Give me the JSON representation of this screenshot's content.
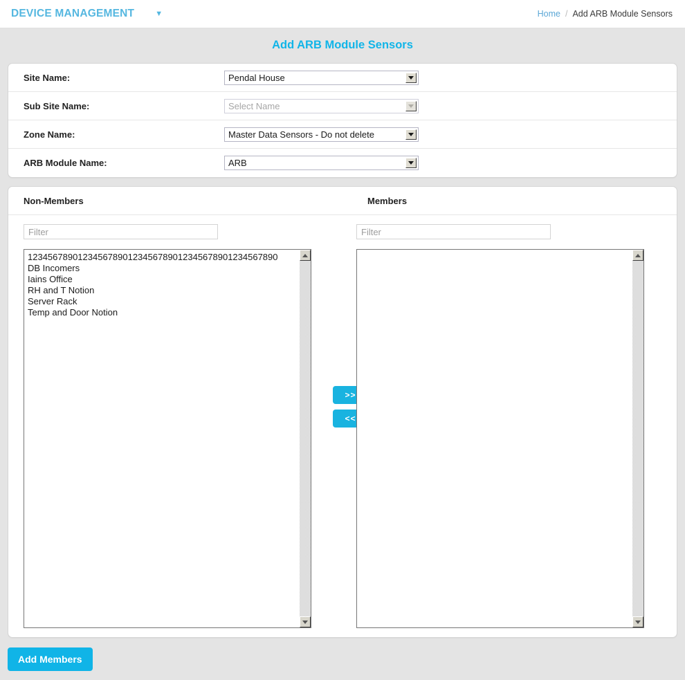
{
  "header": {
    "brand": "DEVICE MANAGEMENT",
    "caret_icon": "chevron-down-icon",
    "breadcrumb": {
      "home": "Home",
      "separator": "/",
      "current": "Add ARB Module Sensors"
    }
  },
  "page": {
    "title": "Add ARB Module Sensors",
    "accent_color": "#12b5e8",
    "background_color": "#e4e4e4"
  },
  "form": {
    "rows": [
      {
        "label": "Site Name:",
        "value": "Pendal House",
        "disabled": false
      },
      {
        "label": "Sub Site Name:",
        "value": "Select Name",
        "disabled": true
      },
      {
        "label": "Zone Name:",
        "value": "Master Data Sensors - Do not delete",
        "disabled": false
      },
      {
        "label": "ARB Module Name:",
        "value": "ARB",
        "disabled": false
      }
    ]
  },
  "dual_list": {
    "nonmembers": {
      "title": "Non-Members",
      "filter_placeholder": "Filter",
      "filter_value": "",
      "items": [
        "12345678901234567890123456789012345678901234567890",
        "DB Incomers",
        "Iains Office",
        "RH and T Notion",
        "Server Rack",
        "Temp and Door Notion"
      ]
    },
    "members": {
      "title": "Members",
      "filter_placeholder": "Filter",
      "filter_value": "",
      "items": []
    },
    "transfer": {
      "to_members_label": ">>",
      "to_nonmembers_label": "<<",
      "button_color": "#19b3e0"
    },
    "scrollbar": {
      "up_icon": "scroll-up-arrow-icon",
      "down_icon": "scroll-down-arrow-icon"
    }
  },
  "footer": {
    "add_members_label": "Add Members"
  }
}
